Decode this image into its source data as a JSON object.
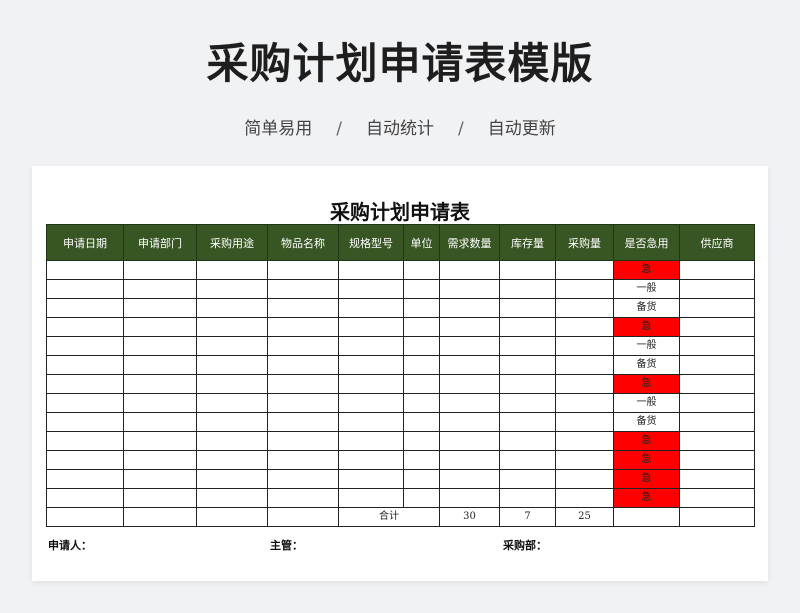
{
  "page": {
    "title": "采购计划申请表模版",
    "features": [
      "简单易用",
      "自动统计",
      "自动更新"
    ],
    "separator": "/"
  },
  "sheet": {
    "title": "采购计划申请表",
    "columns": [
      "申请日期",
      "申请部门",
      "采购用途",
      "物品名称",
      "规格型号",
      "单位",
      "需求数量",
      "库存量",
      "采购量",
      "是否急用",
      "供应商"
    ],
    "urgency_by_row": [
      "急",
      "一般",
      "备货",
      "急",
      "一般",
      "备货",
      "急",
      "一般",
      "备货",
      "急",
      "急",
      "急",
      "急"
    ],
    "urgent_color": "#ff0000",
    "header_color": "#375623",
    "totals": {
      "label": "合计",
      "demand_qty": "30",
      "stock_qty": "7",
      "purchase_qty": "25"
    },
    "footer": {
      "applicant": "申请人：",
      "supervisor": "主管：",
      "purchasing": "采购部："
    }
  }
}
